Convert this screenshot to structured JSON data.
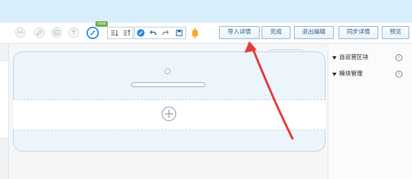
{
  "toolbar": {
    "round_icons": [
      "AA",
      "pen",
      "image",
      "text"
    ],
    "new_badge": "new",
    "buttons": {
      "import_detail": "导入详情",
      "done": "完成",
      "exit_edit": "退出编辑",
      "sync_detail": "同步详情",
      "preview": "预览"
    }
  },
  "right_panel": {
    "items": [
      {
        "label": "自运营区块",
        "info": "i"
      },
      {
        "label": "模块管理",
        "info": "i"
      }
    ]
  },
  "colors": {
    "topbar": "#d9eefb",
    "accent": "#2b8ad8",
    "annotation_arrow": "#e53935",
    "bell": "#f5a623"
  }
}
